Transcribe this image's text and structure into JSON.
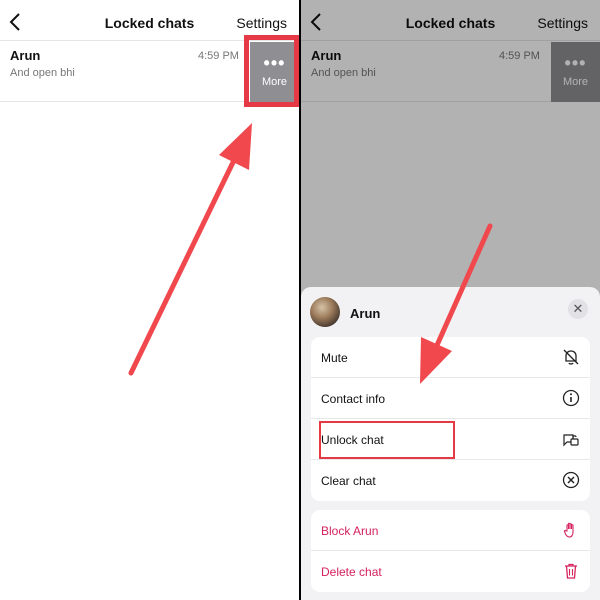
{
  "left": {
    "navbar": {
      "title": "Locked chats",
      "settings": "Settings"
    },
    "chat": {
      "name": "Arun",
      "time": "4:59 PM",
      "preview": "And open bhi"
    },
    "more": {
      "icon": "ellipsis-icon",
      "label": "More"
    }
  },
  "right": {
    "navbar": {
      "title": "Locked chats",
      "settings": "Settings"
    },
    "chat": {
      "name": "Arun",
      "time": "4:59 PM",
      "preview": "And open bhi"
    },
    "more": {
      "icon": "ellipsis-icon",
      "label": "More"
    },
    "sheet": {
      "name": "Arun",
      "close_icon": "close-icon",
      "actions": [
        {
          "label": "Mute",
          "icon": "bell-slash-icon"
        },
        {
          "label": "Contact info",
          "icon": "info-icon"
        },
        {
          "label": "Unlock chat",
          "icon": "unlock-icon"
        },
        {
          "label": "Clear chat",
          "icon": "clear-circle-x-icon"
        }
      ],
      "danger_actions": [
        {
          "label": "Block Arun",
          "icon": "hand-icon"
        },
        {
          "label": "Delete chat",
          "icon": "trash-icon"
        }
      ]
    }
  },
  "colors": {
    "annotation": "#e53945",
    "danger": "#d6215d",
    "more_bg": "#8e8e93"
  }
}
